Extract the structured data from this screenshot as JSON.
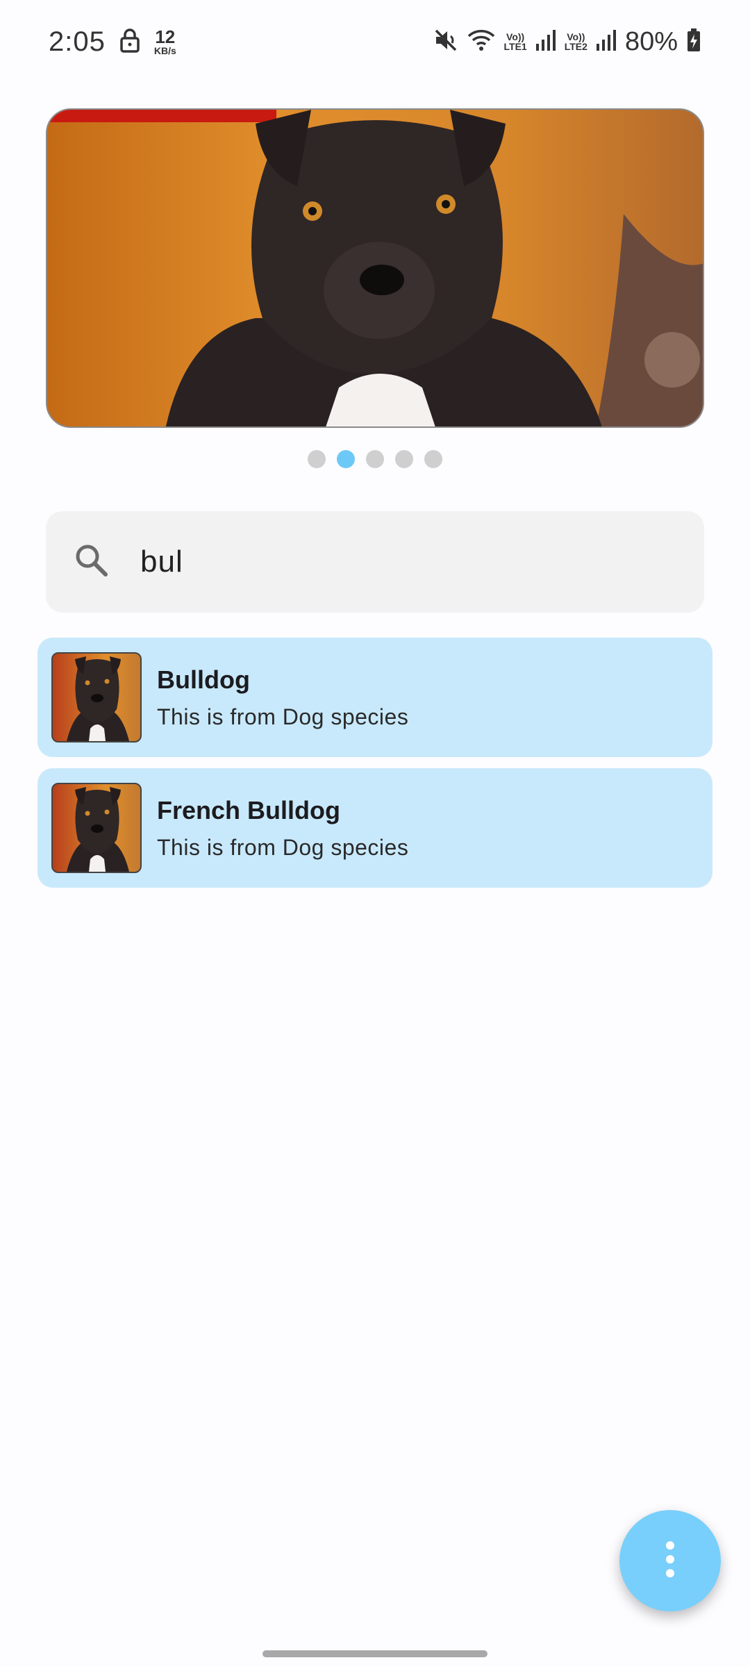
{
  "status_bar": {
    "time": "2:05",
    "net_speed_value": "12",
    "net_speed_unit": "KB/s",
    "sim1_label_top": "Vo))",
    "sim1_label_bottom": "LTE1",
    "sim2_label_top": "Vo))",
    "sim2_label_bottom": "LTE2",
    "battery_text": "80%",
    "icons": [
      "lock-icon",
      "mute-icon",
      "wifi-icon",
      "signal-icon",
      "battery-charging-icon"
    ]
  },
  "carousel": {
    "image": "black-dog-photo",
    "page_count": 5,
    "active_index": 1
  },
  "search": {
    "value": "bul",
    "icon": "search-icon"
  },
  "results": [
    {
      "title": "Bulldog",
      "subtitle": "This is from Dog species",
      "thumbnail": "black-dog-photo"
    },
    {
      "title": "French Bulldog",
      "subtitle": "This is from Dog species",
      "thumbnail": "black-dog-photo"
    }
  ],
  "fab": {
    "icon": "more-vertical-icon"
  },
  "colors": {
    "accent": "#78cffb",
    "active_dot": "#6cc9f7",
    "list_item_bg": "#c8e9fb",
    "search_bg": "#f2f2f3"
  }
}
